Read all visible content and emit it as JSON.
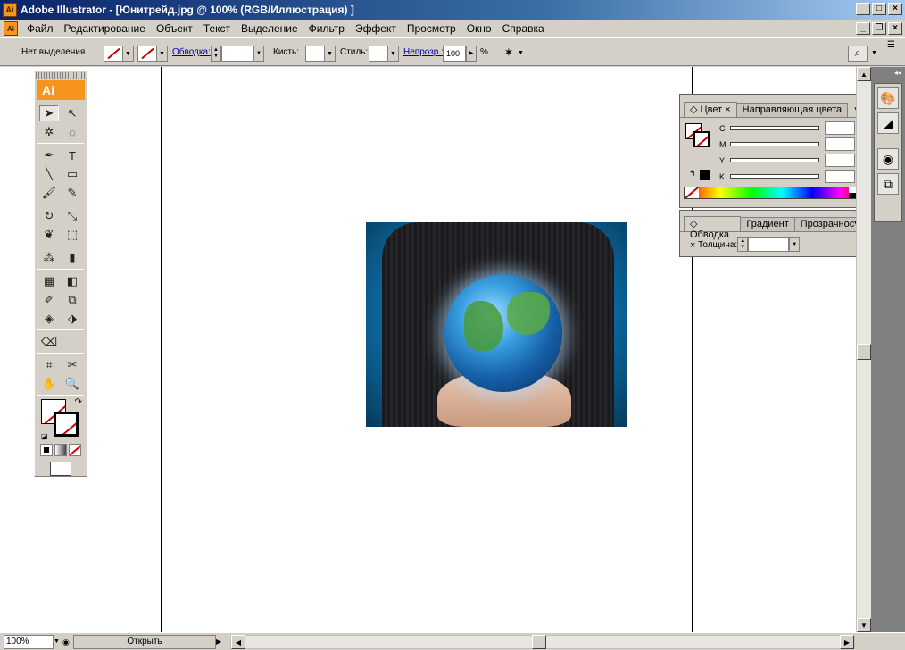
{
  "window": {
    "title": "Adobe Illustrator - [Юнитрейд.jpg @ 100% (RGB/Иллюстрация) ]",
    "app_icon": "Ai",
    "buttons": {
      "minimize": "_",
      "maximize": "□",
      "close": "×"
    }
  },
  "menubar": {
    "doc_icon": "Ai",
    "items": [
      {
        "label": "Файл"
      },
      {
        "label": "Редактирование"
      },
      {
        "label": "Объект"
      },
      {
        "label": "Текст"
      },
      {
        "label": "Выделение"
      },
      {
        "label": "Фильтр"
      },
      {
        "label": "Эффект"
      },
      {
        "label": "Просмотр"
      },
      {
        "label": "Окно"
      },
      {
        "label": "Справка"
      }
    ],
    "doc_buttons": {
      "minimize": "_",
      "restore": "❐",
      "close": "×"
    }
  },
  "controlbar": {
    "selection_status": "Нет выделения",
    "stroke_link": "Обводка:",
    "brush_label": "Кисть:",
    "style_label": "Стиль:",
    "opacity_link": "Непрозр.:",
    "opacity_value": "100",
    "opacity_unit": "%"
  },
  "toolbox": {
    "header": "Ai"
  },
  "color_panel": {
    "tabs": [
      "Цвет",
      "Направляющая цвета"
    ],
    "close_glyph": "×",
    "channels": [
      {
        "label": "C",
        "value": "",
        "unit": "%"
      },
      {
        "label": "M",
        "value": "",
        "unit": "%"
      },
      {
        "label": "Y",
        "value": "",
        "unit": "%"
      },
      {
        "label": "K",
        "value": "",
        "unit": "%"
      }
    ]
  },
  "stroke_panel": {
    "tabs": [
      "Обводка",
      "Градиент",
      "Прозрачность"
    ],
    "close_glyph": "×",
    "weight_label": "Толщина:",
    "weight_value": ""
  },
  "statusbar": {
    "zoom": "100%",
    "status": "Открыть"
  },
  "colors": {
    "title_start": "#0a246a",
    "title_end": "#a6caf0",
    "ai_orange": "#f7941d",
    "none_slash": "#cc0000",
    "link_blue": "#0000aa"
  }
}
